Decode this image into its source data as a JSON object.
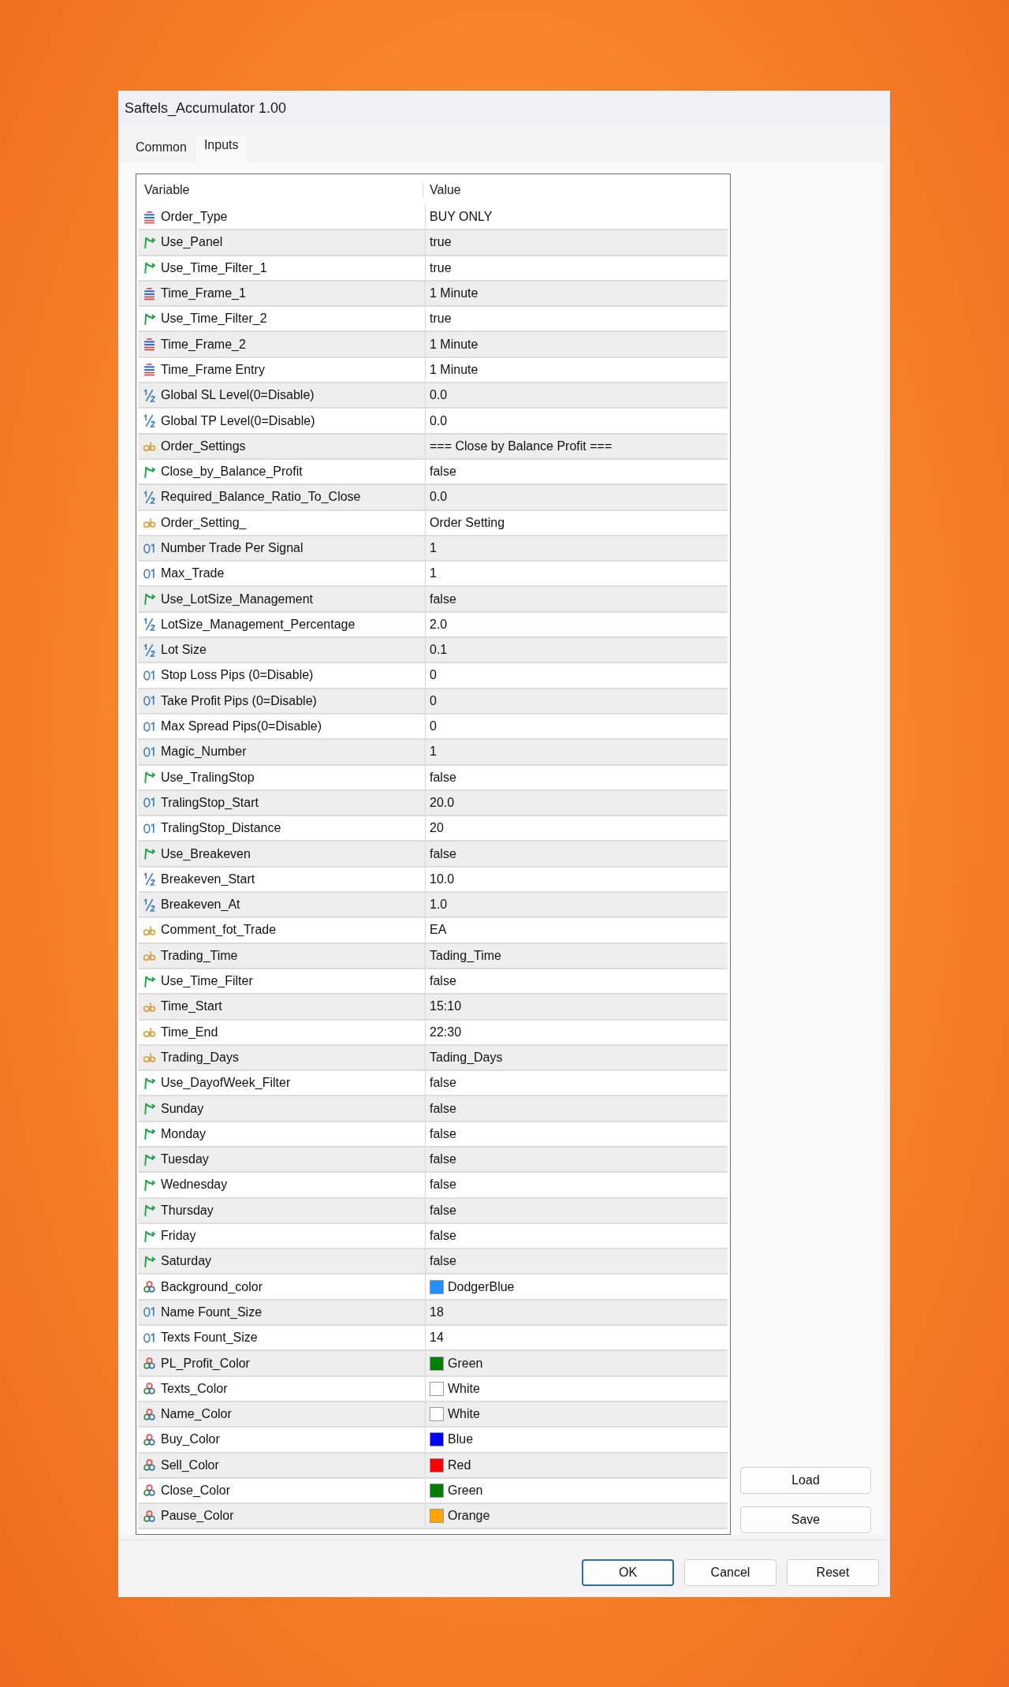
{
  "window": {
    "title": "Saftels_Accumulator 1.00"
  },
  "tabs": [
    {
      "label": "Common",
      "selected": false
    },
    {
      "label": "Inputs",
      "selected": true
    }
  ],
  "table": {
    "columns": [
      "Variable",
      "Value"
    ],
    "rows": [
      {
        "kind": "enum",
        "variable": "Order_Type",
        "value": "BUY ONLY"
      },
      {
        "kind": "bool",
        "variable": "Use_Panel",
        "value": "true"
      },
      {
        "kind": "bool",
        "variable": "Use_Time_Filter_1",
        "value": "true"
      },
      {
        "kind": "enum",
        "variable": "Time_Frame_1",
        "value": "1 Minute"
      },
      {
        "kind": "bool",
        "variable": "Use_Time_Filter_2",
        "value": "true"
      },
      {
        "kind": "enum",
        "variable": "Time_Frame_2",
        "value": "1 Minute"
      },
      {
        "kind": "enum",
        "variable": "Time_Frame Entry",
        "value": "1 Minute"
      },
      {
        "kind": "double",
        "variable": "Global SL Level(0=Disable)",
        "value": "0.0"
      },
      {
        "kind": "double",
        "variable": "Global TP Level(0=Disable)",
        "value": "0.0"
      },
      {
        "kind": "string",
        "variable": "Order_Settings",
        "value": "=== Close by Balance Profit ==="
      },
      {
        "kind": "bool",
        "variable": "Close_by_Balance_Profit",
        "value": "false"
      },
      {
        "kind": "double",
        "variable": "Required_Balance_Ratio_To_Close",
        "value": "0.0"
      },
      {
        "kind": "string",
        "variable": "Order_Setting_",
        "value": "Order Setting"
      },
      {
        "kind": "int",
        "variable": "Number Trade Per Signal",
        "value": "1"
      },
      {
        "kind": "int",
        "variable": "Max_Trade",
        "value": "1"
      },
      {
        "kind": "bool",
        "variable": "Use_LotSize_Management",
        "value": "false"
      },
      {
        "kind": "double",
        "variable": "LotSize_Management_Percentage",
        "value": "2.0"
      },
      {
        "kind": "double",
        "variable": "Lot Size",
        "value": "0.1"
      },
      {
        "kind": "int",
        "variable": "Stop Loss Pips (0=Disable)",
        "value": "0"
      },
      {
        "kind": "int",
        "variable": "Take Profit Pips (0=Disable)",
        "value": "0"
      },
      {
        "kind": "int",
        "variable": "Max Spread Pips(0=Disable)",
        "value": "0"
      },
      {
        "kind": "int",
        "variable": "Magic_Number",
        "value": "1"
      },
      {
        "kind": "bool",
        "variable": "Use_TralingStop",
        "value": "false"
      },
      {
        "kind": "int",
        "variable": "TralingStop_Start",
        "value": "20.0"
      },
      {
        "kind": "int",
        "variable": "TralingStop_Distance",
        "value": "20"
      },
      {
        "kind": "bool",
        "variable": "Use_Breakeven",
        "value": "false"
      },
      {
        "kind": "double",
        "variable": "Breakeven_Start",
        "value": "10.0"
      },
      {
        "kind": "double",
        "variable": "Breakeven_At",
        "value": "1.0"
      },
      {
        "kind": "string",
        "variable": "Comment_fot_Trade",
        "value": "EA"
      },
      {
        "kind": "string",
        "variable": "Trading_Time",
        "value": "Tading_Time"
      },
      {
        "kind": "bool",
        "variable": "Use_Time_Filter",
        "value": "false"
      },
      {
        "kind": "string",
        "variable": "Time_Start",
        "value": "15:10"
      },
      {
        "kind": "string",
        "variable": "Time_End",
        "value": "22:30"
      },
      {
        "kind": "string",
        "variable": "Trading_Days",
        "value": "Tading_Days"
      },
      {
        "kind": "bool",
        "variable": "Use_DayofWeek_Filter",
        "value": "false"
      },
      {
        "kind": "bool",
        "variable": "Sunday",
        "value": "false"
      },
      {
        "kind": "bool",
        "variable": "Monday",
        "value": "false"
      },
      {
        "kind": "bool",
        "variable": "Tuesday",
        "value": "false"
      },
      {
        "kind": "bool",
        "variable": "Wednesday",
        "value": "false"
      },
      {
        "kind": "bool",
        "variable": "Thursday",
        "value": "false"
      },
      {
        "kind": "bool",
        "variable": "Friday",
        "value": "false"
      },
      {
        "kind": "bool",
        "variable": "Saturday",
        "value": "false"
      },
      {
        "kind": "color",
        "variable": "Background_color",
        "value": "DodgerBlue",
        "color": "#1e90ff"
      },
      {
        "kind": "int",
        "variable": "Name Fount_Size",
        "value": "18"
      },
      {
        "kind": "int",
        "variable": "Texts Fount_Size",
        "value": "14"
      },
      {
        "kind": "color",
        "variable": "PL_Profit_Color",
        "value": "Green",
        "color": "#008000"
      },
      {
        "kind": "color",
        "variable": "Texts_Color",
        "value": "White",
        "color": "#ffffff"
      },
      {
        "kind": "color",
        "variable": "Name_Color",
        "value": "White",
        "color": "#ffffff"
      },
      {
        "kind": "color",
        "variable": "Buy_Color",
        "value": "Blue",
        "color": "#0000ff"
      },
      {
        "kind": "color",
        "variable": "Sell_Color",
        "value": "Red",
        "color": "#ff0000"
      },
      {
        "kind": "color",
        "variable": "Close_Color",
        "value": "Green",
        "color": "#008000"
      },
      {
        "kind": "color",
        "variable": "Pause_Color",
        "value": "Orange",
        "color": "#ffa500"
      }
    ]
  },
  "side_buttons": [
    "Load",
    "Save"
  ],
  "footer_buttons": [
    {
      "label": "OK",
      "kind": "default"
    },
    {
      "label": "Cancel",
      "kind": "normal"
    },
    {
      "label": "Reset",
      "kind": "normal"
    }
  ]
}
